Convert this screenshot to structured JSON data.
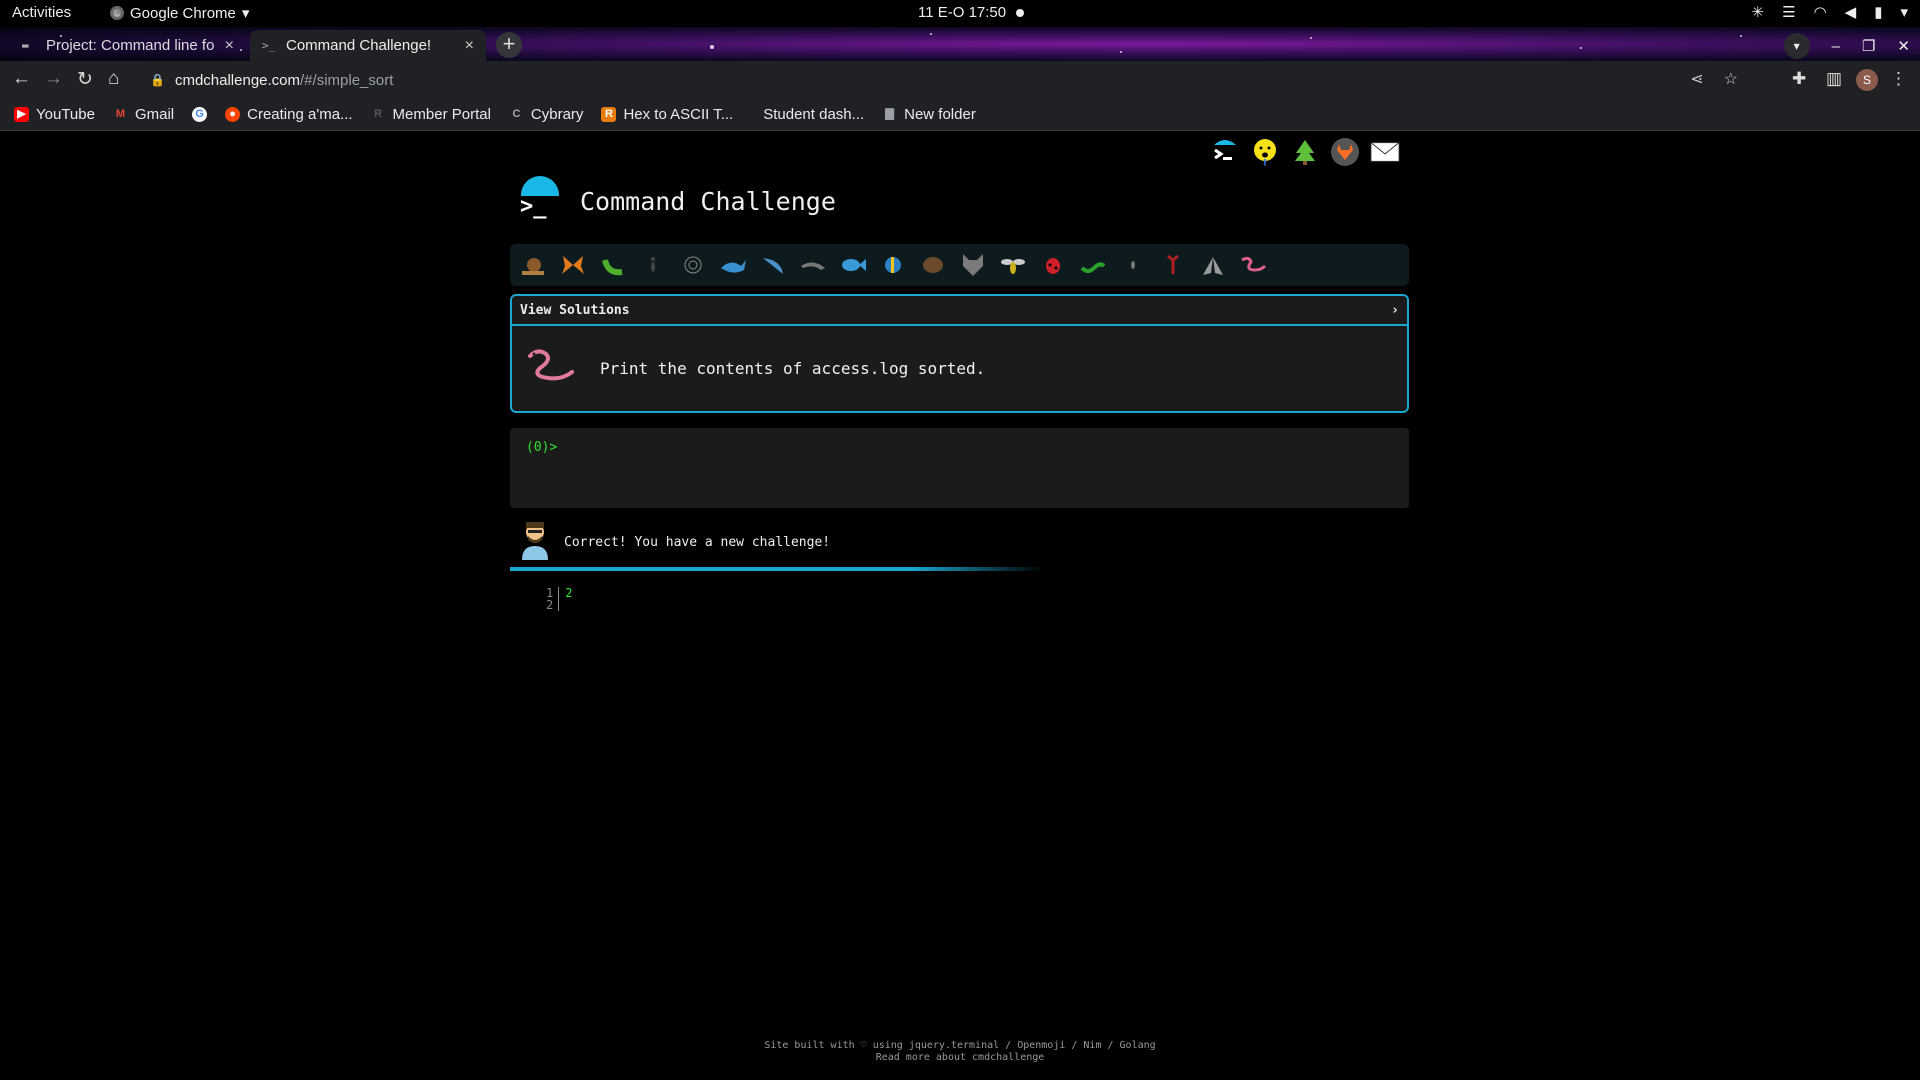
{
  "topbar": {
    "activities": "Activities",
    "app_name": "Google Chrome",
    "clock": "11 E-O  17:50"
  },
  "tabs": [
    {
      "title": "Project: Command line fo",
      "favicon": "terminal-icon"
    },
    {
      "title": "Command Challenge!",
      "favicon": "terminal-icon"
    }
  ],
  "omnibox": {
    "host": "cmdchallenge.com",
    "path": "/#/simple_sort"
  },
  "bookmarks": [
    {
      "label": "YouTube",
      "icon": "youtube-icon",
      "color": "#ff0000"
    },
    {
      "label": "Gmail",
      "icon": "gmail-icon",
      "color": "#ea4335"
    },
    {
      "label": "",
      "icon": "google-icon",
      "color": "#4285f4"
    },
    {
      "label": "Creating a'ma...",
      "icon": "reddit-icon",
      "color": "#ff4500"
    },
    {
      "label": "Member Portal",
      "icon": "portal-icon",
      "color": "#333333"
    },
    {
      "label": "Cybrary",
      "icon": "cybrary-icon",
      "color": "#555555"
    },
    {
      "label": "Hex to ASCII T...",
      "icon": "rapidtables-icon",
      "color": "#e87d0d"
    },
    {
      "label": "Student dash...",
      "icon": "none",
      "color": "#202124"
    },
    {
      "label": "New folder",
      "icon": "folder-icon",
      "color": "#9aa0a6"
    }
  ],
  "site": {
    "title": "Command Challenge",
    "view_solutions": "View Solutions",
    "task": "Print the contents of access.log sorted.",
    "prompt": "(0)>",
    "feedback": "Correct! You have a new challenge!",
    "output_line_numbers": [
      "1",
      "2"
    ],
    "output_lines": [
      "2",
      ""
    ],
    "footer_line1": "Site built with ♡ using jquery.terminal / Openmoji / Nim / Golang",
    "footer_line2": "Read more about cmdchallenge"
  },
  "level_icons": [
    "snail-icon",
    "butterfly-icon",
    "caterpillar-icon",
    "ant-icon",
    "spider-web-icon",
    "whale-icon",
    "shark-icon",
    "dolphin-icon",
    "fish-icon",
    "tropical-fish-icon",
    "beaver-icon",
    "wolf-icon",
    "bee-icon",
    "ladybug-icon",
    "worm-icon",
    "mosquito-icon",
    "scorpion-icon",
    "fly-icon",
    "worm-pink-icon"
  ],
  "colors": {
    "accent": "#1aa7d0",
    "terminal_green": "#2fe02f"
  }
}
